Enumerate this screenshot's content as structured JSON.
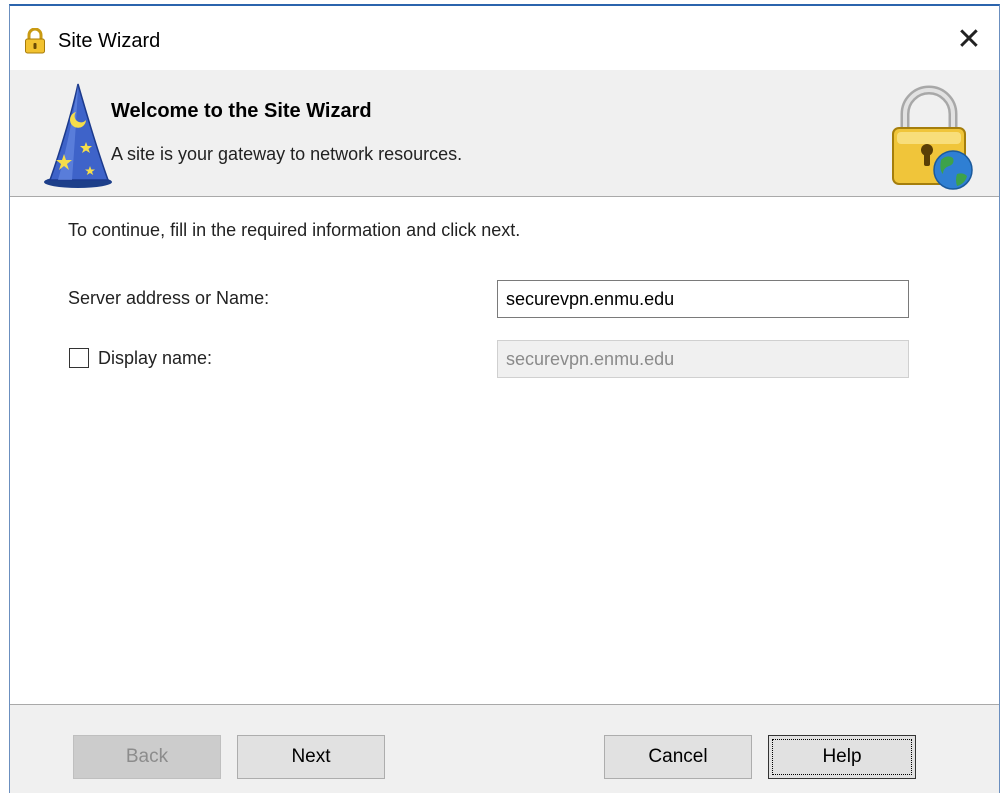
{
  "window": {
    "title": "Site Wizard",
    "title_icon": "lock-icon",
    "close_glyph": "✕"
  },
  "header": {
    "title": "Welcome to the Site Wizard",
    "subtitle": "A site is your gateway to network resources.",
    "left_icon": "wizard-hat-icon",
    "right_icon": "lock-globe-icon"
  },
  "main": {
    "instructions": "To continue, fill in the required information and click next.",
    "server_label": "Server address or Name:",
    "server_value": "securevpn.enmu.edu",
    "display_label": "Display name:",
    "display_checked": false,
    "display_value": "securevpn.enmu.edu"
  },
  "footer": {
    "back_label": "Back",
    "next_label": "Next",
    "cancel_label": "Cancel",
    "help_label": "Help"
  },
  "colors": {
    "accent_border": "#2b64ad",
    "header_bg": "#f0f0f0",
    "button_bg": "#e1e1e1"
  }
}
